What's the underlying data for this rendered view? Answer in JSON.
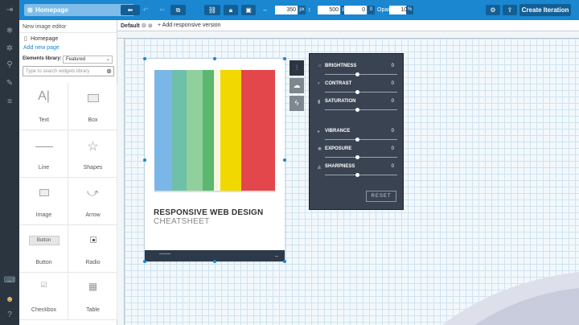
{
  "toolbar": {
    "page_button": "Homepage",
    "x_value": "350",
    "x_unit": "px",
    "y_value": "500",
    "y_unit": "px",
    "angle_value": "0",
    "angle_unit": "0",
    "opacity_label": "Opacity:",
    "opacity_value": "100",
    "opacity_unit": "%",
    "create_button": "Create Iteration"
  },
  "left_panel": {
    "editor_title": "New image editor",
    "page_item": "Homepage",
    "add_page": "Add new page",
    "library_label": "Elements library:",
    "library_value": "Featured",
    "search_placeholder": "Type to search widgets library",
    "widgets": [
      {
        "label": "Text"
      },
      {
        "label": "Box"
      },
      {
        "label": "Line"
      },
      {
        "label": "Shapes"
      },
      {
        "label": "Image"
      },
      {
        "label": "Arrow"
      },
      {
        "label": "Button",
        "preview": "Button"
      },
      {
        "label": "Radio"
      },
      {
        "label": "Checkbox"
      },
      {
        "label": "Table"
      }
    ]
  },
  "canvas": {
    "tab_default": "Default",
    "tab_add": "+ Add responsive version",
    "image_title": "RESPONSIVE WEB DESIGN",
    "image_subtitle": "CHEATSHEET"
  },
  "chart_data": {
    "type": "bar",
    "colors": [
      "#7ab6e8",
      "#6fc0a8",
      "#8fd09c",
      "#5bb86e",
      "#f6f6e0",
      "#f1d800",
      "#e3464b"
    ]
  },
  "filters": [
    {
      "label": "BRIGHTNESS",
      "value": "0",
      "icon": "sun-icon"
    },
    {
      "label": "CONTRAST",
      "value": "0",
      "icon": "contrast-icon"
    },
    {
      "label": "SATURATION",
      "value": "0",
      "icon": "drop-icon"
    },
    {
      "label": "VIBRANCE",
      "value": "0",
      "icon": "vibrance-icon"
    },
    {
      "label": "EXPOSURE",
      "value": "0",
      "icon": "exposure-icon"
    },
    {
      "label": "SHARPNESS",
      "value": "0",
      "icon": "sharpness-icon"
    }
  ],
  "reset_label": "RESET"
}
